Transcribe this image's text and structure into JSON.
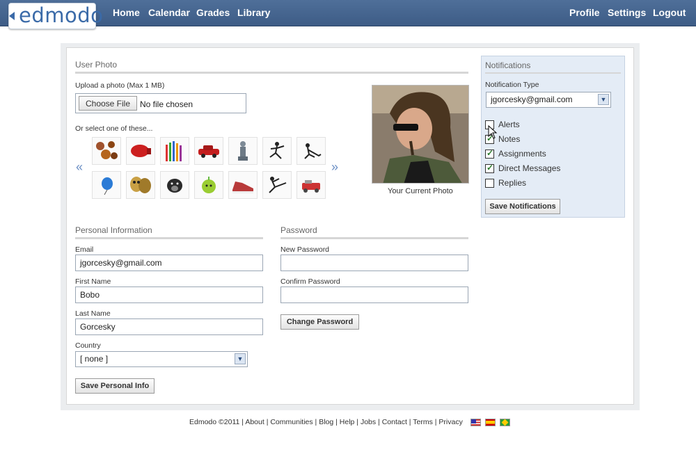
{
  "topbar": {
    "logo": "edmodo",
    "nav_left": [
      "Home",
      "Calendar",
      "Grades",
      "Library"
    ],
    "nav_right": [
      "Profile",
      "Settings",
      "Logout"
    ]
  },
  "photo": {
    "title": "User Photo",
    "upload_label": "Upload a photo   (Max 1 MB)",
    "choose_button": "Choose File",
    "file_status": "No file chosen",
    "select_label": "Or select one of these...",
    "current_caption": "Your Current Photo",
    "prev_arrow": "«",
    "next_arrow": "»",
    "avatars": [
      "cookies-icon",
      "boxing-glove-icon",
      "pencils-icon",
      "red-car-icon",
      "statue-icon",
      "dancer-icon",
      "hockey-icon",
      "balloon-icon",
      "theater-masks-icon",
      "dog-icon",
      "apple-icon",
      "sneakers-icon",
      "karate-icon",
      "robot-icon"
    ]
  },
  "personal": {
    "title": "Personal Information",
    "email_label": "Email",
    "email_value": "jgorcesky@gmail.com",
    "first_label": "First Name",
    "first_value": "Bobo",
    "last_label": "Last Name",
    "last_value": "Gorcesky",
    "country_label": "Country",
    "country_value": "[ none ]",
    "save_button": "Save Personal Info"
  },
  "password": {
    "title": "Password",
    "new_label": "New Password",
    "confirm_label": "Confirm Password",
    "change_button": "Change Password"
  },
  "notifications": {
    "title": "Notifications",
    "type_label": "Notification Type",
    "type_value": "jgorcesky@gmail.com",
    "items": [
      {
        "label": "Alerts",
        "checked": false
      },
      {
        "label": "Notes",
        "checked": true
      },
      {
        "label": "Assignments",
        "checked": true
      },
      {
        "label": "Direct Messages",
        "checked": true
      },
      {
        "label": "Replies",
        "checked": false
      }
    ],
    "save_button": "Save Notifications"
  },
  "footer": {
    "copyright": "Edmodo ©2011",
    "links": [
      "About",
      "Communities",
      "Blog",
      "Help",
      "Jobs",
      "Contact",
      "Terms",
      "Privacy"
    ]
  }
}
